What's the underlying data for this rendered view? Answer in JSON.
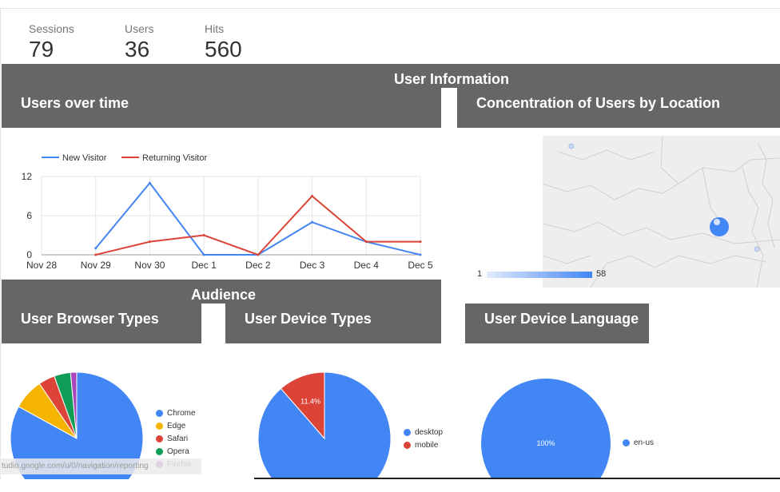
{
  "kpis": [
    {
      "label": "Sessions",
      "value": "79"
    },
    {
      "label": "Users",
      "value": "36"
    },
    {
      "label": "Hits",
      "value": "560"
    }
  ],
  "sections": {
    "user_information": "User Information",
    "users_over_time": "Users over time",
    "concentration": "Concentration of Users by Location",
    "audience": "Audience",
    "browser_types": "User Browser Types",
    "device_types": "User Device Types",
    "device_language": "User Device Language"
  },
  "map_legend": {
    "min": "1",
    "max": "58"
  },
  "status_url": "tudio.google.com/u/0/navigation/reporting",
  "colors": {
    "blue": "#4285f4",
    "red": "#db4437",
    "yellow": "#f4b400",
    "green": "#0f9d58",
    "purple": "#ab47bc",
    "band": "#666666"
  },
  "chart_data": [
    {
      "type": "line",
      "title": "Users over time",
      "x": [
        "Nov 28",
        "Nov 29",
        "Nov 30",
        "Dec 1",
        "Dec 2",
        "Dec 3",
        "Dec 4",
        "Dec 5"
      ],
      "ylim": [
        0,
        12
      ],
      "yticks": [
        "0",
        "6",
        "12"
      ],
      "series": [
        {
          "name": "New Visitor",
          "color": "#4285f4",
          "values": [
            null,
            1,
            11,
            0,
            0,
            5,
            2,
            0
          ]
        },
        {
          "name": "Returning Visitor",
          "color": "#db4437",
          "values": [
            null,
            0,
            2,
            3,
            0,
            9,
            2,
            2
          ]
        }
      ],
      "grid": true,
      "legend": "top-left"
    },
    {
      "type": "pie",
      "title": "User Browser Types",
      "labels": [
        "Chrome",
        "Edge",
        "Safari",
        "Opera",
        "Firefox"
      ],
      "values": [
        83,
        7.5,
        4,
        4,
        1.5
      ],
      "colors": [
        "#4285f4",
        "#f4b400",
        "#db4437",
        "#0f9d58",
        "#ab47bc"
      ]
    },
    {
      "type": "pie",
      "title": "User Device Types",
      "labels": [
        "desktop",
        "mobile"
      ],
      "values": [
        88.6,
        11.4
      ],
      "data_labels": [
        "",
        "11.4%"
      ],
      "colors": [
        "#4285f4",
        "#db4437"
      ]
    },
    {
      "type": "pie",
      "title": "User Device Language",
      "labels": [
        "en-us"
      ],
      "values": [
        100
      ],
      "data_labels": [
        "100%"
      ],
      "colors": [
        "#4285f4"
      ]
    }
  ]
}
